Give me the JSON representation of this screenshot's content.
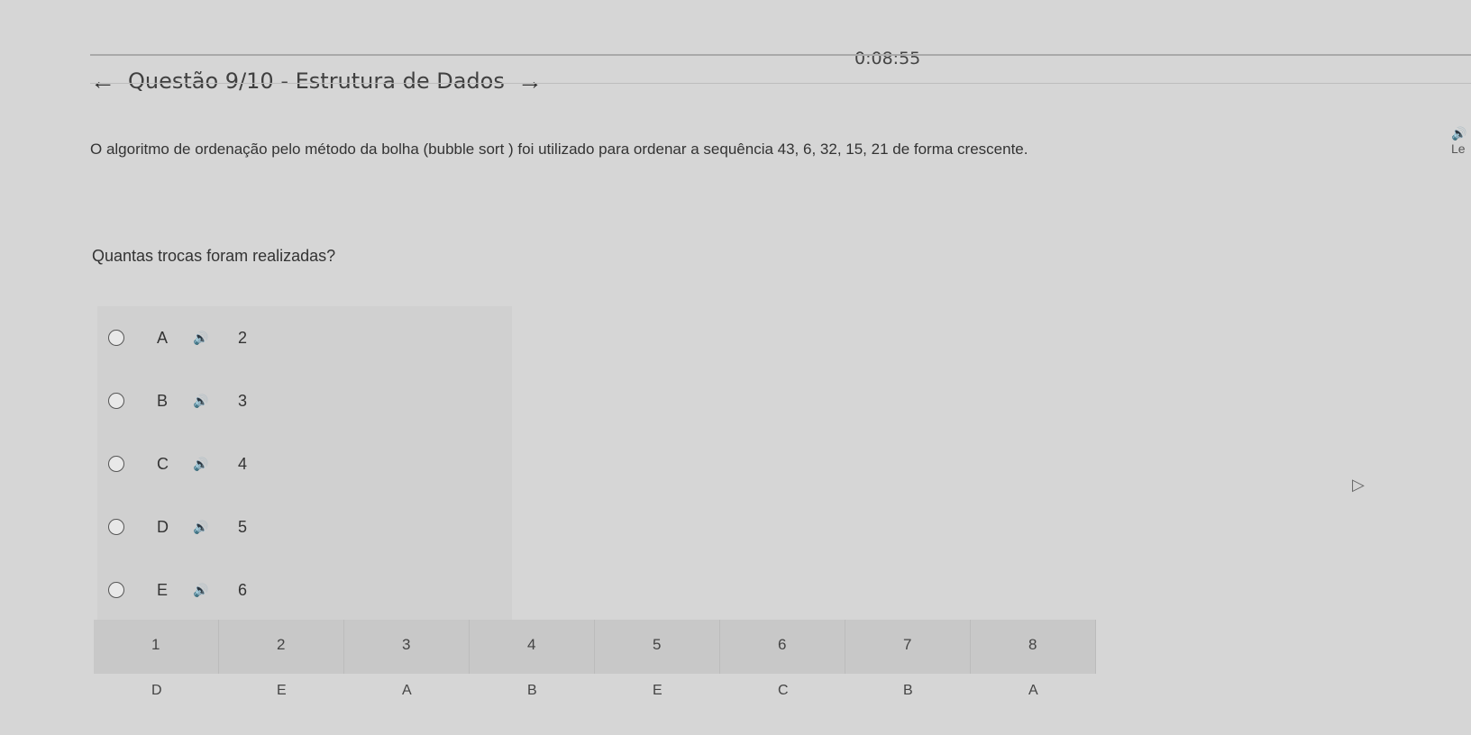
{
  "timer": "0:08:55",
  "header": {
    "prev_icon": "←",
    "title": "Questão 9/10 - Estrutura de Dados",
    "next_icon": "→"
  },
  "listen_label": "🔊 Le",
  "question": {
    "stem": "O algoritmo de ordenação pelo método da bolha (bubble sort ) foi utilizado para ordenar a sequência 43, 6, 32, 15, 21 de forma crescente.",
    "prompt": "Quantas trocas foram realizadas?"
  },
  "speaker_icon": "🔊",
  "options": [
    {
      "letter": "A",
      "value": "2"
    },
    {
      "letter": "B",
      "value": "3"
    },
    {
      "letter": "C",
      "value": "4"
    },
    {
      "letter": "D",
      "value": "5"
    },
    {
      "letter": "E",
      "value": "6"
    }
  ],
  "navigator": {
    "numbers": [
      "1",
      "2",
      "3",
      "4",
      "5",
      "6",
      "7",
      "8"
    ],
    "answers": [
      "D",
      "E",
      "A",
      "B",
      "E",
      "C",
      "B",
      "A"
    ]
  }
}
